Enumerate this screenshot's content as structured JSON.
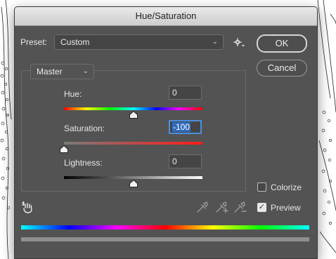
{
  "window": {
    "title": "Hue/Saturation"
  },
  "preset": {
    "label": "Preset:",
    "value": "Custom"
  },
  "channel": {
    "value": "Master"
  },
  "buttons": {
    "ok": "OK",
    "cancel": "Cancel"
  },
  "sliders": {
    "hue": {
      "label": "Hue:",
      "value": "0",
      "min": -180,
      "max": 180
    },
    "saturation": {
      "label": "Saturation:",
      "value": "-100",
      "min": -100,
      "max": 100
    },
    "lightness": {
      "label": "Lightness:",
      "value": "0",
      "min": -100,
      "max": 100
    }
  },
  "options": {
    "colorize": {
      "label": "Colorize",
      "checked": false
    },
    "preview": {
      "label": "Preview",
      "checked": true
    }
  },
  "icons": {
    "gear": "gear-icon",
    "hand": "targeted-adjustment-hand-icon",
    "eyedropper": "eyedropper-icon",
    "eyedropper_plus": "eyedropper-add-icon",
    "eyedropper_minus": "eyedropper-subtract-icon"
  }
}
